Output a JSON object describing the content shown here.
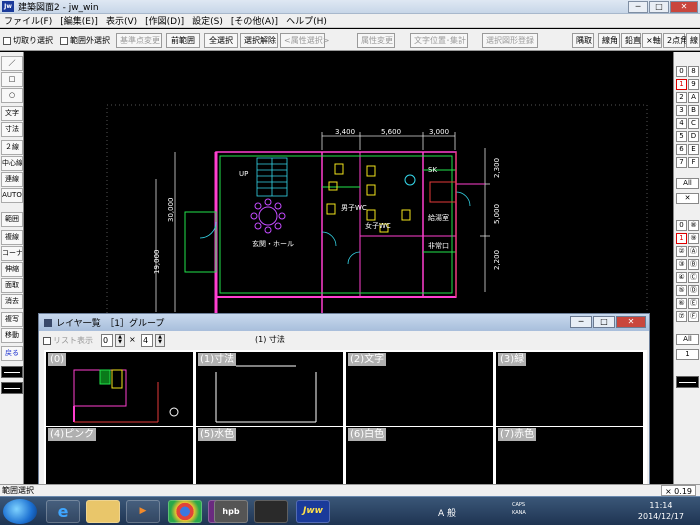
{
  "window": {
    "title": "建築図面2 - jw_win",
    "icon_label": "Jw",
    "btn_minimize": "─",
    "btn_maximize": "□",
    "btn_close": "✕"
  },
  "menu": [
    "ファイル(F)",
    "[編集(E)]",
    "表示(V)",
    "[作図(D)]",
    "設定(S)",
    "[その他(A)]",
    "ヘルプ(H)"
  ],
  "toolbar": {
    "cut_select": "切取り選択",
    "outside_select": "範囲外選択",
    "base_change": "基準点変更",
    "prev_range": "前範囲",
    "select_all": "全選択",
    "deselect": "選択解除",
    "attr_select": "<属性選択>",
    "attr_change": "属性変更",
    "text_pos": "文字位置･集計",
    "register": "選択図形登録",
    "right_buttons": [
      "隅取",
      "線角",
      "鉛直",
      "×軸",
      "2点角",
      "線"
    ]
  },
  "left_tools": [
    "／",
    "□",
    "○",
    "文字",
    "寸法",
    "２線",
    "中心線",
    "連線",
    "AUTO",
    "範囲",
    "複線",
    "コーナー",
    "伸縮",
    "面取",
    "消去",
    "複写",
    "移動",
    "戻る"
  ],
  "right_palette": {
    "top_rows": [
      [
        "0",
        "8"
      ],
      [
        "1",
        "9"
      ],
      [
        "2",
        "A"
      ],
      [
        "3",
        "B"
      ],
      [
        "4",
        "C"
      ],
      [
        "5",
        "D"
      ],
      [
        "6",
        "E"
      ],
      [
        "7",
        "F"
      ]
    ],
    "all_label": "All",
    "x_label": "✕",
    "bottom_rows": [
      [
        "0",
        "⑧"
      ],
      [
        "1",
        "⑨"
      ],
      [
        "②",
        "Ⓐ"
      ],
      [
        "③",
        "Ⓑ"
      ],
      [
        "④",
        "Ⓒ"
      ],
      [
        "⑤",
        "Ⓓ"
      ],
      [
        "⑥",
        "Ⓔ"
      ],
      [
        "⑦",
        "Ⓕ"
      ]
    ],
    "all2_label": "All",
    "num_label": "1"
  },
  "drawing": {
    "dims_top": [
      "3,400",
      "5,600",
      "3,000"
    ],
    "dim_left": "30,000",
    "dim_left2": "19,000",
    "dims_right": [
      "2,300",
      "5,000",
      "2,200"
    ],
    "labels": {
      "up": "UP",
      "hall": "玄関・ホール",
      "men": "男子WC",
      "women": "女子WC",
      "sk": "SK",
      "kitchen": "給湯室",
      "exit": "非常口"
    }
  },
  "layer_dialog": {
    "title": "レイヤ一覧　［1］グループ",
    "list_option": "リスト表示",
    "spin1": "0",
    "times": "×",
    "spin2": "4",
    "center_label": "(1) 寸法",
    "panels": [
      "(0)",
      "(1)寸法",
      "(2)文字",
      "(3)緑",
      "(4)ピンク",
      "(5)水色",
      "(6)白色",
      "(7)赤色"
    ]
  },
  "status": {
    "left": "範囲選択",
    "right": "× 0.19"
  },
  "taskbar": {
    "apps": [
      "e",
      "",
      "▶",
      "",
      "",
      "hpb",
      "",
      "Jww"
    ],
    "ime": "A 般",
    "caps": "CAPS",
    "kana": "KANA",
    "time": "11:14",
    "date": "2014/12/17"
  }
}
